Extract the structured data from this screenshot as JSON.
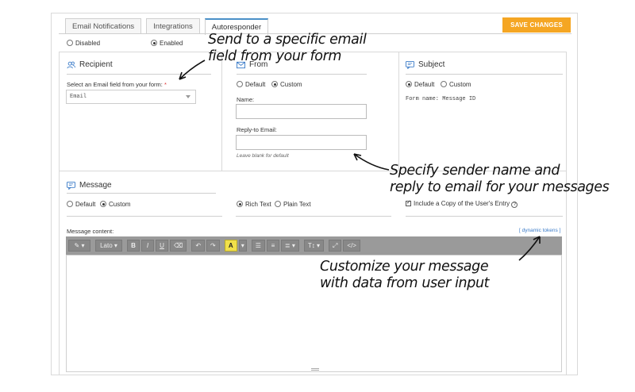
{
  "tabs": [
    "Email Notifications",
    "Integrations",
    "Autoresponder"
  ],
  "save_button": "SAVE CHANGES",
  "status": {
    "disabled": "Disabled",
    "enabled": "Enabled",
    "selected": "enabled"
  },
  "recipient": {
    "title": "Recipient",
    "field_label": "Select an Email field from your form:",
    "required_mark": "*",
    "select_value": "Email"
  },
  "from": {
    "title": "From",
    "default_label": "Default",
    "custom_label": "Custom",
    "selected": "custom",
    "name_label": "Name:",
    "name_value": "",
    "reply_label": "Reply-to Email:",
    "reply_value": "",
    "reply_hint": "Leave blank for default"
  },
  "subject": {
    "title": "Subject",
    "default_label": "Default",
    "custom_label": "Custom",
    "selected": "default",
    "preview": "Form name: Message ID"
  },
  "message": {
    "title": "Message",
    "default_label": "Default",
    "custom_label": "Custom",
    "selected": "custom",
    "rich_text_label": "Rich Text",
    "plain_text_label": "Plain Text",
    "format": "rich",
    "include_copy_label": "Include a Copy of the User's Entry",
    "include_copy_checked": true,
    "content_label": "Message content:",
    "dynamic_tokens_link": "[ dynamic tokens ]",
    "content_value": ""
  },
  "toolbar": {
    "style_icon": "magic-wand-icon",
    "font": "Lato",
    "bold": "B",
    "italic": "I",
    "underline": "U",
    "clear_icon": "eraser-icon",
    "undo_icon": "undo-icon",
    "redo_icon": "redo-icon",
    "color": "A",
    "ul_icon": "bullet-list-icon",
    "ol_icon": "numbered-list-icon",
    "align_icon": "align-icon",
    "height_label": "T↕",
    "fullscreen_icon": "fullscreen-icon",
    "code_icon": "code-view-icon"
  },
  "annotations": {
    "recipient_note_1": "Send to a specific email",
    "recipient_note_2": "field from your form",
    "sender_note_1": "Specify sender name and",
    "sender_note_2": "reply to email for your messages",
    "message_note_1": "Customize your message",
    "message_note_2": "with data from user input"
  },
  "colors": {
    "accent": "#f5a623",
    "tab_active": "#4a90c8",
    "link": "#3a7bc8",
    "icon_blue": "#3a7bc8"
  }
}
